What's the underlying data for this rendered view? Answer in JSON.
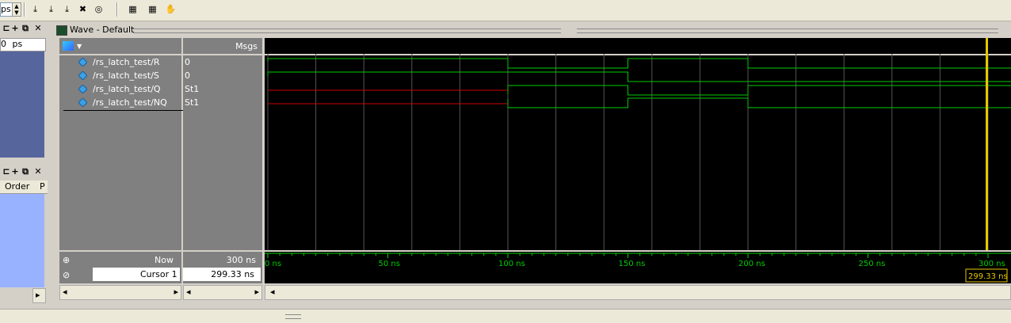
{
  "toolbar": {
    "time_unit": "ps",
    "buttons": [
      {
        "name": "step-icon",
        "glyph": "⤓"
      },
      {
        "name": "step-over-icon",
        "glyph": "⤓"
      },
      {
        "name": "step-out-icon",
        "glyph": "⤓"
      },
      {
        "name": "break-icon",
        "glyph": "✖"
      },
      {
        "name": "restart-icon",
        "glyph": "◎"
      },
      {
        "name": "dataflow-icon",
        "glyph": "▦"
      },
      {
        "name": "dataflow-trace-icon",
        "glyph": "▦"
      },
      {
        "name": "hand-pan-icon",
        "glyph": "✋"
      }
    ]
  },
  "left_pane": {
    "time_field": "0",
    "time_unit": "ps",
    "header2": {
      "col1": "Order",
      "col2": "P"
    }
  },
  "wave_window": {
    "title": "Wave - Default",
    "msgs_header": "Msgs",
    "signals": [
      {
        "name": "/rs_latch_test/R",
        "value": "0",
        "color": "#00cc00"
      },
      {
        "name": "/rs_latch_test/S",
        "value": "0",
        "color": "#00cc00"
      },
      {
        "name": "/rs_latch_test/Q",
        "value": "St1",
        "color": "#00cc00"
      },
      {
        "name": "/rs_latch_test/NQ",
        "value": "St1",
        "color": "#00cc00"
      }
    ],
    "now_label": "Now",
    "now_value": "300 ns",
    "cursor_label": "Cursor 1",
    "cursor_value": "299.33 ns",
    "cursor_flag": "299.33 ns",
    "time_ticks": [
      "0 ns",
      "50 ns",
      "100 ns",
      "150 ns",
      "200 ns",
      "250 ns",
      "300 ns"
    ],
    "colors": {
      "wave": "#00cc00",
      "undefined": "#cc0000",
      "cursor": "#e6c800",
      "grid": "#555555"
    }
  }
}
